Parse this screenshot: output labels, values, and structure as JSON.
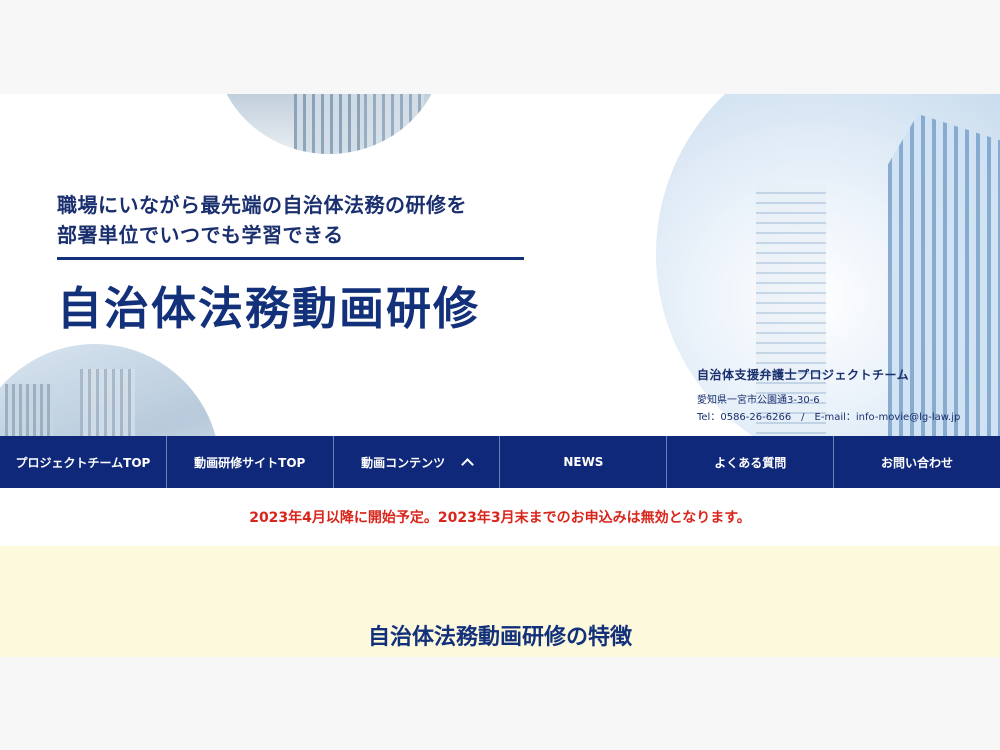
{
  "hero": {
    "tagline_line1": "職場にいながら最先端の自治体法務の研修を",
    "tagline_line2": "部署単位でいつでも学習できる",
    "title": "自治体法務動画研修"
  },
  "org": {
    "name": "自治体支援弁護士プロジェクトチーム",
    "address": "愛知県一宮市公園通3-30-6",
    "contact": "Tel：0586-26-6266　/　E-mail：info-movie@lg-law.jp"
  },
  "nav": {
    "items": [
      {
        "label": "プロジェクトチームTOP"
      },
      {
        "label": "動画研修サイトTOP"
      },
      {
        "label": "動画コンテンツ"
      },
      {
        "label": "NEWS"
      },
      {
        "label": "よくある質問"
      },
      {
        "label": "お問い合わせ"
      }
    ]
  },
  "notice": "2023年4月以降に開始予定。2023年3月末までのお申込みは無効となります。",
  "features": {
    "title": "自治体法務動画研修の特徴"
  },
  "colors": {
    "brand": "#13307a",
    "nav_bg": "#10287a",
    "notice": "#d8261c",
    "features_bg": "#fdf9dc"
  }
}
